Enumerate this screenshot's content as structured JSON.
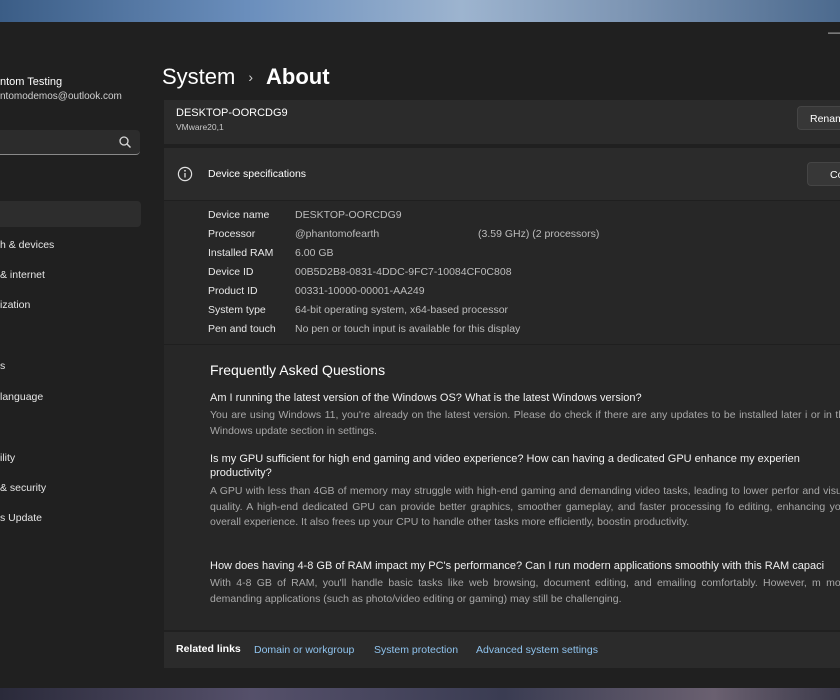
{
  "window": {
    "minimize_glyph": "—"
  },
  "profile": {
    "name": "ntom Testing",
    "email": "ntomodemos@outlook.com"
  },
  "search": {
    "icon": "search-icon"
  },
  "sidebar": {
    "items": [
      {
        "label": "h & devices"
      },
      {
        "label": "& internet"
      },
      {
        "label": "ization"
      },
      {
        "label": "s"
      },
      {
        "label": "language"
      },
      {
        "label": "ility"
      },
      {
        "label": "& security"
      },
      {
        "label": "s Update"
      }
    ]
  },
  "breadcrumb": {
    "parent": "System",
    "separator": "›",
    "current": "About"
  },
  "device": {
    "name": "DESKTOP-OORCDG9",
    "model": "VMware20,1",
    "rename_label": "Renam"
  },
  "specs": {
    "header": "Device specifications",
    "icon": "info-icon",
    "copy_label": "Co",
    "rows": [
      {
        "label": "Device name",
        "value": "DESKTOP-OORCDG9"
      },
      {
        "label": "Processor",
        "value": "@phantomofearth",
        "extra": "(3.59 GHz) (2 processors)"
      },
      {
        "label": "Installed RAM",
        "value": "6.00 GB"
      },
      {
        "label": "Device ID",
        "value": "00B5D2B8-0831-4DDC-9FC7-10084CF0C808"
      },
      {
        "label": "Product ID",
        "value": "00331-10000-00001-AA249"
      },
      {
        "label": "System type",
        "value": "64-bit operating system, x64-based processor"
      },
      {
        "label": "Pen and touch",
        "value": "No pen or touch input is available for this display"
      }
    ]
  },
  "faq": {
    "title": "Frequently Asked Questions",
    "items": [
      {
        "q": "Am I running the latest version of the Windows OS? What is the latest Windows version?",
        "a": "You are using Windows 11, you're already on the latest version. Please do check if there are any updates to be installed later i or in the Windows update section in settings."
      },
      {
        "q": "Is my GPU sufficient for high end gaming and video experience? How can having a dedicated GPU enhance my experien productivity?",
        "a": "A GPU with less than 4GB of memory may struggle with high-end gaming and demanding video tasks, leading to lower perfor and visual quality. A high-end dedicated GPU can provide better graphics, smoother gameplay, and faster processing fo editing, enhancing your overall experience. It also frees up your CPU to handle other tasks more efficiently, boostin productivity."
      },
      {
        "q": "How does having 4-8 GB of RAM impact my PC's performance? Can I run modern applications smoothly with this RAM capaci",
        "a": "With 4-8 GB of RAM, you'll handle basic tasks like web browsing, document editing, and emailing comfortably. However, m more demanding applications (such as photo/video editing or gaming) may still be challenging."
      }
    ]
  },
  "related": {
    "title": "Related links",
    "links": [
      {
        "label": "Domain or workgroup"
      },
      {
        "label": "System protection"
      },
      {
        "label": "Advanced system settings"
      }
    ]
  },
  "colors": {
    "accent_link": "#8fc3ee",
    "window_bg": "#202020",
    "card_bg": "#2b2b2b"
  }
}
